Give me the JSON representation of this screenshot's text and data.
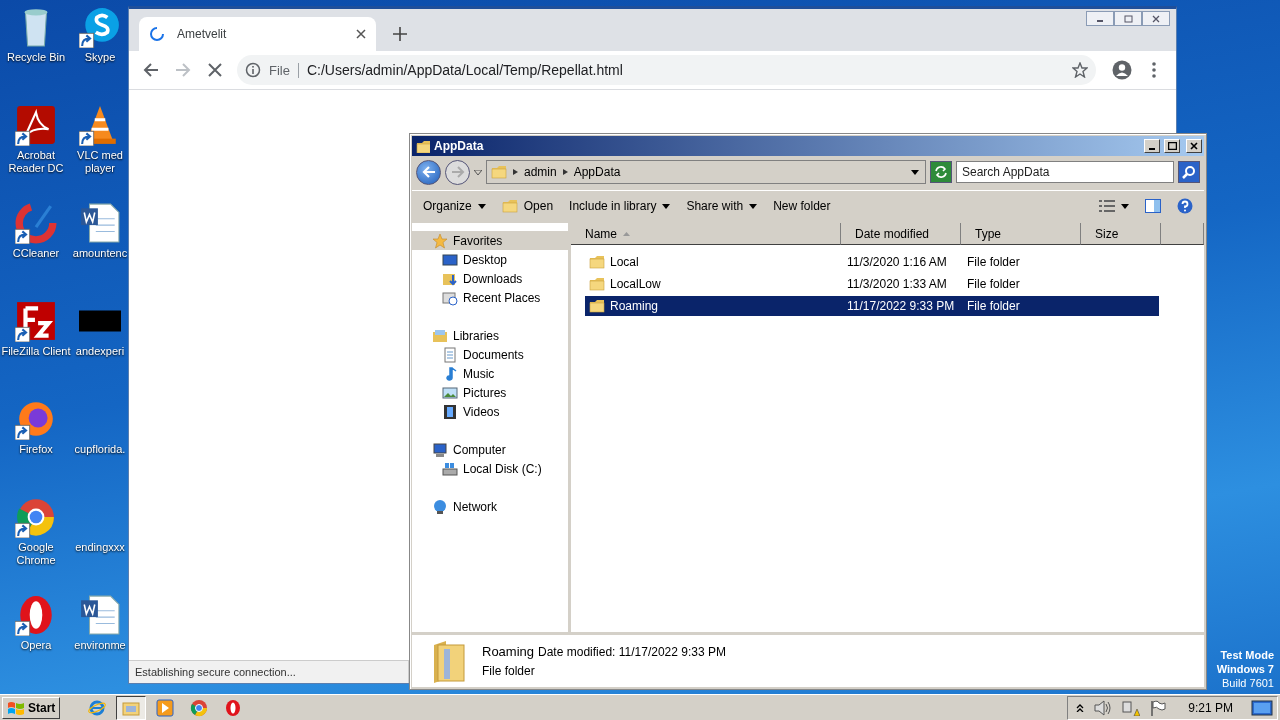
{
  "desktop": {
    "icons": [
      {
        "label": "Recycle Bin",
        "kind": "recycle"
      },
      {
        "label": "Skype",
        "kind": "skype",
        "shortcut": true
      },
      {
        "label": "Acrobat Reader DC",
        "kind": "acrobat",
        "shortcut": true
      },
      {
        "label": "VLC med player",
        "kind": "vlc",
        "shortcut": true
      },
      {
        "label": "CCleaner",
        "kind": "ccleaner",
        "shortcut": true
      },
      {
        "label": "amountenc",
        "kind": "word"
      },
      {
        "label": "FileZilla Client",
        "kind": "filezilla",
        "shortcut": true
      },
      {
        "label": "andexperi",
        "kind": "thumb"
      },
      {
        "label": "Firefox",
        "kind": "firefox",
        "shortcut": true
      },
      {
        "label": "cupflorida.",
        "kind": "blank"
      },
      {
        "label": "Google Chrome",
        "kind": "chrome",
        "shortcut": true
      },
      {
        "label": "endingxxx",
        "kind": "blank"
      },
      {
        "label": "Opera",
        "kind": "opera",
        "shortcut": true
      },
      {
        "label": "environme",
        "kind": "word"
      }
    ],
    "test_mode": [
      "Test Mode",
      "Windows 7",
      "Build 7601"
    ]
  },
  "browser": {
    "tabs": [
      {
        "title": "Ametvelit",
        "loading": true,
        "selected": true
      }
    ],
    "scheme": "File",
    "url": "C:/Users/admin/AppData/Local/Temp/Repellat.html",
    "loading": true,
    "status": "Establishing secure connection..."
  },
  "explorer": {
    "title": "AppData",
    "breadcrumb": [
      "admin",
      "AppData"
    ],
    "search": {
      "placeholder": "Search AppData"
    },
    "toolbar": [
      {
        "label": "Organize",
        "kind": "menu"
      },
      {
        "label": "Open",
        "kind": "open"
      },
      {
        "label": "Include in library",
        "kind": "menu"
      },
      {
        "label": "Share with",
        "kind": "menu"
      },
      {
        "label": "New folder",
        "kind": "button"
      }
    ],
    "nav": [
      {
        "label": "Favorites",
        "kind": "star",
        "selected": true,
        "children": [
          {
            "label": "Desktop",
            "kind": "desktop",
            "selected": false
          },
          {
            "label": "Downloads",
            "kind": "downloads",
            "selected": false
          },
          {
            "label": "Recent Places",
            "kind": "recent",
            "selected": false
          }
        ]
      },
      {
        "label": "Libraries",
        "kind": "libraries",
        "selected": false,
        "children": [
          {
            "label": "Documents",
            "kind": "documents",
            "selected": false
          },
          {
            "label": "Music",
            "kind": "music",
            "selected": false
          },
          {
            "label": "Pictures",
            "kind": "pictures",
            "selected": false
          },
          {
            "label": "Videos",
            "kind": "videos",
            "selected": false
          }
        ]
      },
      {
        "label": "Computer",
        "kind": "computer",
        "selected": false,
        "children": [
          {
            "label": "Local Disk (C:)",
            "kind": "disk",
            "selected": false
          }
        ]
      },
      {
        "label": "Network",
        "kind": "network",
        "selected": false
      }
    ],
    "columns": [
      "Name",
      "Date modified",
      "Type",
      "Size"
    ],
    "rows": [
      {
        "name": "Local",
        "date": "11/3/2020 1:16 AM",
        "type": "File folder",
        "selected": false
      },
      {
        "name": "LocalLow",
        "date": "11/3/2020 1:33 AM",
        "type": "File folder",
        "selected": false
      },
      {
        "name": "Roaming",
        "date": "11/17/2022 9:33 PM",
        "type": "File folder",
        "selected": true
      }
    ],
    "details": {
      "name": "Roaming",
      "meta": "Date modified: 11/17/2022 9:33 PM",
      "type": "File folder"
    }
  },
  "taskbar": {
    "start": "Start",
    "apps": [
      {
        "kind": "ie",
        "active": false
      },
      {
        "kind": "explorer",
        "active": true
      },
      {
        "kind": "media",
        "active": false
      },
      {
        "kind": "chrome",
        "active": false
      },
      {
        "kind": "opera",
        "active": false
      }
    ],
    "clock": "9:21 PM"
  }
}
